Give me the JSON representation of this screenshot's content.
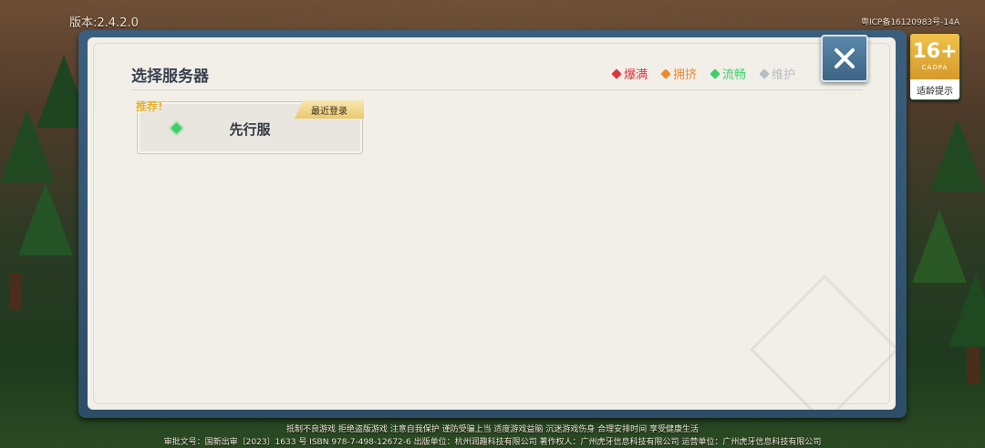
{
  "version": "版本:2.4.2.0",
  "icp": "粤ICP备16120983号-14A",
  "age_badge": {
    "age": "16+",
    "org": "CADPA",
    "label": "适龄提示"
  },
  "dialog": {
    "title": "选择服务器",
    "legend": [
      {
        "label": "爆满",
        "color": "#e2353f"
      },
      {
        "label": "拥挤",
        "color": "#f0892e"
      },
      {
        "label": "流畅",
        "color": "#3fcf6a"
      },
      {
        "label": "维护",
        "color": "#b8bcc4"
      }
    ],
    "servers": [
      {
        "name": "先行服",
        "recommend": "推荐!",
        "tag": "最近登录",
        "status": "流畅",
        "status_color": "#3fcf6a"
      }
    ]
  },
  "footer": {
    "line1": "抵制不良游戏  拒绝盗版游戏  注意自我保护  谨防受骗上当  适度游戏益脑  沉迷游戏伤身  合理安排时间  享受健康生活",
    "line2": "审批文号：国新出审〔2023〕1633 号    ISBN 978-7-498-12672-6    出版单位：杭州润趣科技有限公司    著作权人：广州虎牙信息科技有限公司    运营单位：广州虎牙信息科技有限公司"
  }
}
